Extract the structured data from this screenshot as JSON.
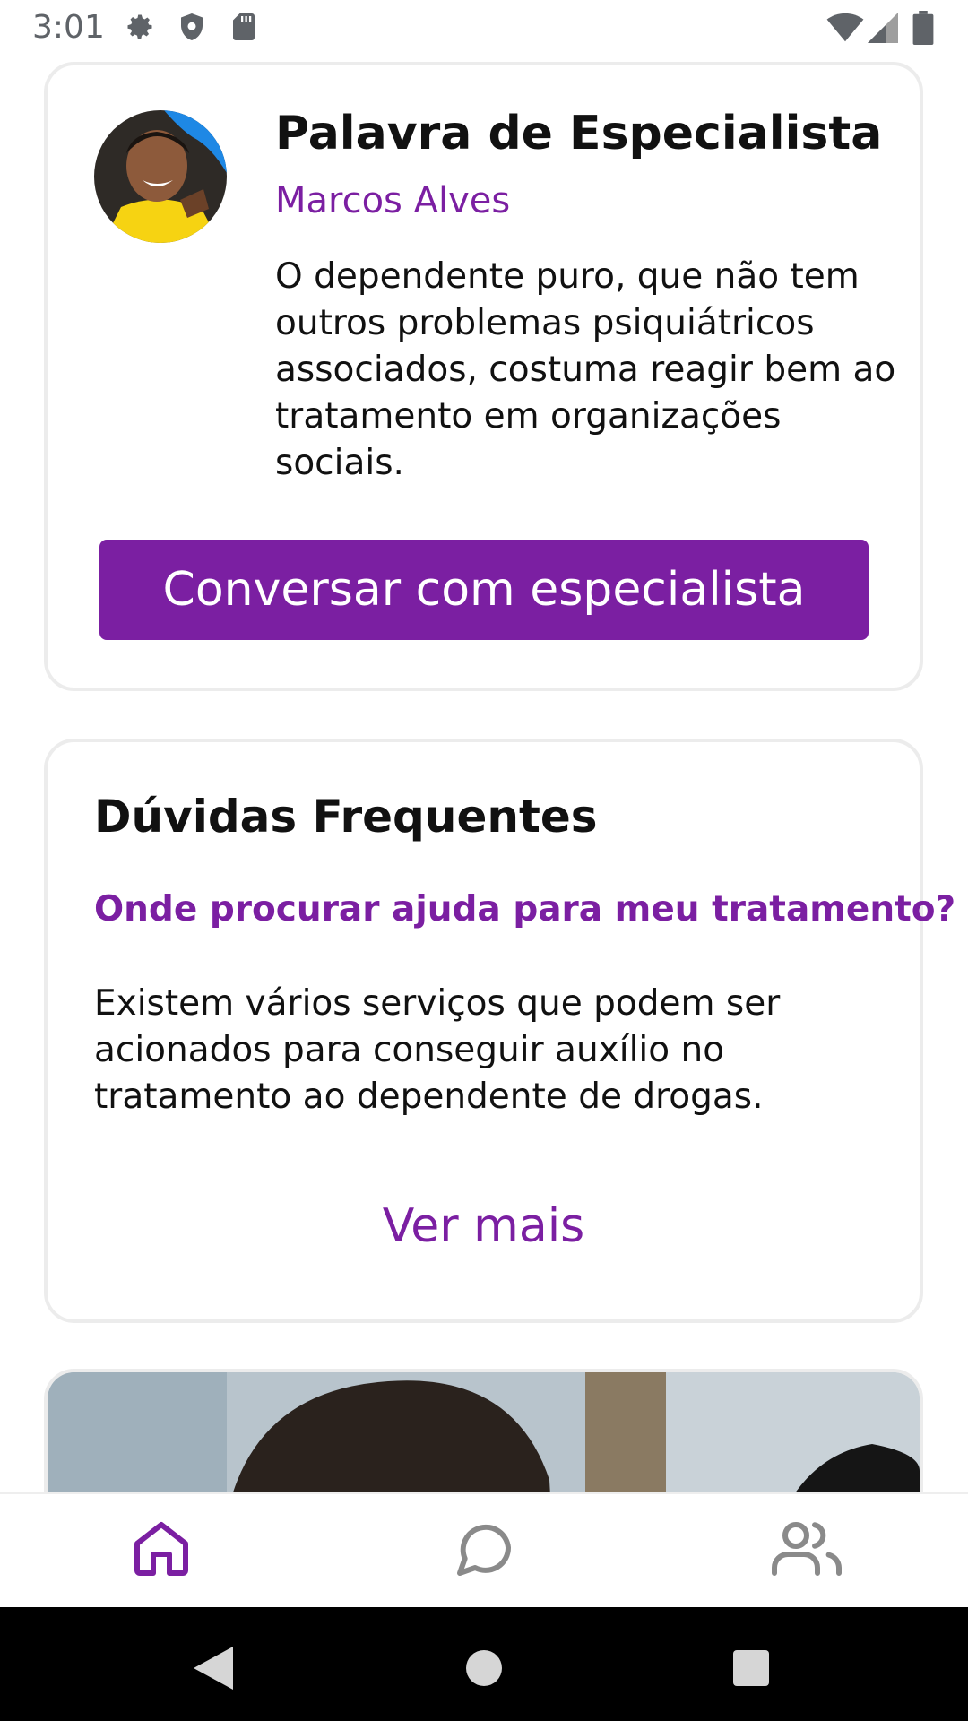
{
  "status_bar": {
    "time": "3:01",
    "left_icons": [
      "gear-icon",
      "shield-icon",
      "sd-card-icon"
    ],
    "right_icons": [
      "wifi-icon",
      "signal-icon",
      "battery-icon"
    ]
  },
  "expert_card": {
    "title": "Palavra de Especialista",
    "name": "Marcos Alves",
    "quote": "O dependente puro, que não tem outros problemas psiquiátricos associados, costuma reagir bem ao tratamento em organizações sociais.",
    "button_label": "Conversar com especialista"
  },
  "faq_card": {
    "title": "Dúvidas Frequentes",
    "question": "Onde procurar ajuda para meu tratamento?",
    "answer": "Existem vários serviços que podem ser acionados para conseguir auxílio no tratamento ao dependente de drogas.",
    "see_more_label": "Ver mais"
  },
  "bottom_nav": {
    "items": [
      {
        "icon": "home-icon",
        "active": true
      },
      {
        "icon": "chat-icon",
        "active": false
      },
      {
        "icon": "users-icon",
        "active": false
      }
    ]
  },
  "system_nav": {
    "buttons": [
      "back-icon",
      "home-circle-icon",
      "recents-icon"
    ]
  },
  "colors": {
    "accent": "#7b1fa2",
    "text": "#111111",
    "card_border": "#ececec",
    "inactive_icon": "#8a8a8a"
  }
}
